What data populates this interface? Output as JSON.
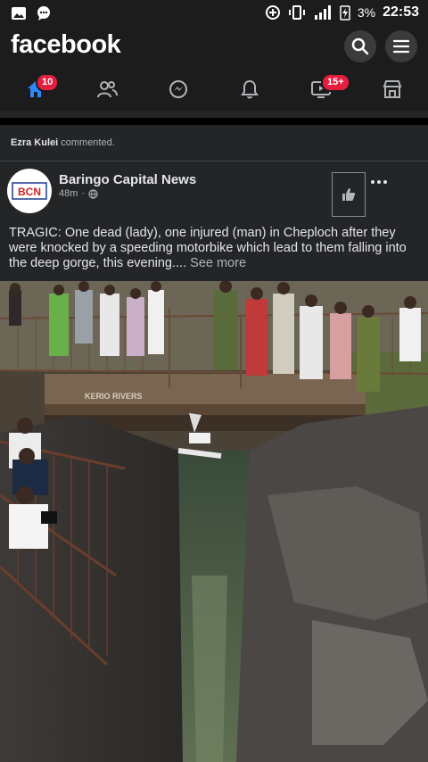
{
  "status_bar": {
    "battery": "3%",
    "time": "22:53"
  },
  "header": {
    "logo": "facebook"
  },
  "nav": {
    "home_badge": "10",
    "watch_badge": "15+"
  },
  "activity": {
    "user": "Ezra Kulei",
    "action": " commented."
  },
  "post": {
    "page_name": "Baringo Capital News",
    "time": "48m",
    "separator": "·",
    "avatar_text": "BCN",
    "text": "TRAGIC: One dead (lady), one injured (man) in Cheploch after they were knocked by a speeding motorbike which lead to them falling into the deep gorge, this evening....",
    "see_more": " See more",
    "sign_text": "KERIO RIVERS"
  },
  "colors": {
    "accent": "#e41e3f",
    "blue": "#2d88ff",
    "background": "#242526"
  }
}
